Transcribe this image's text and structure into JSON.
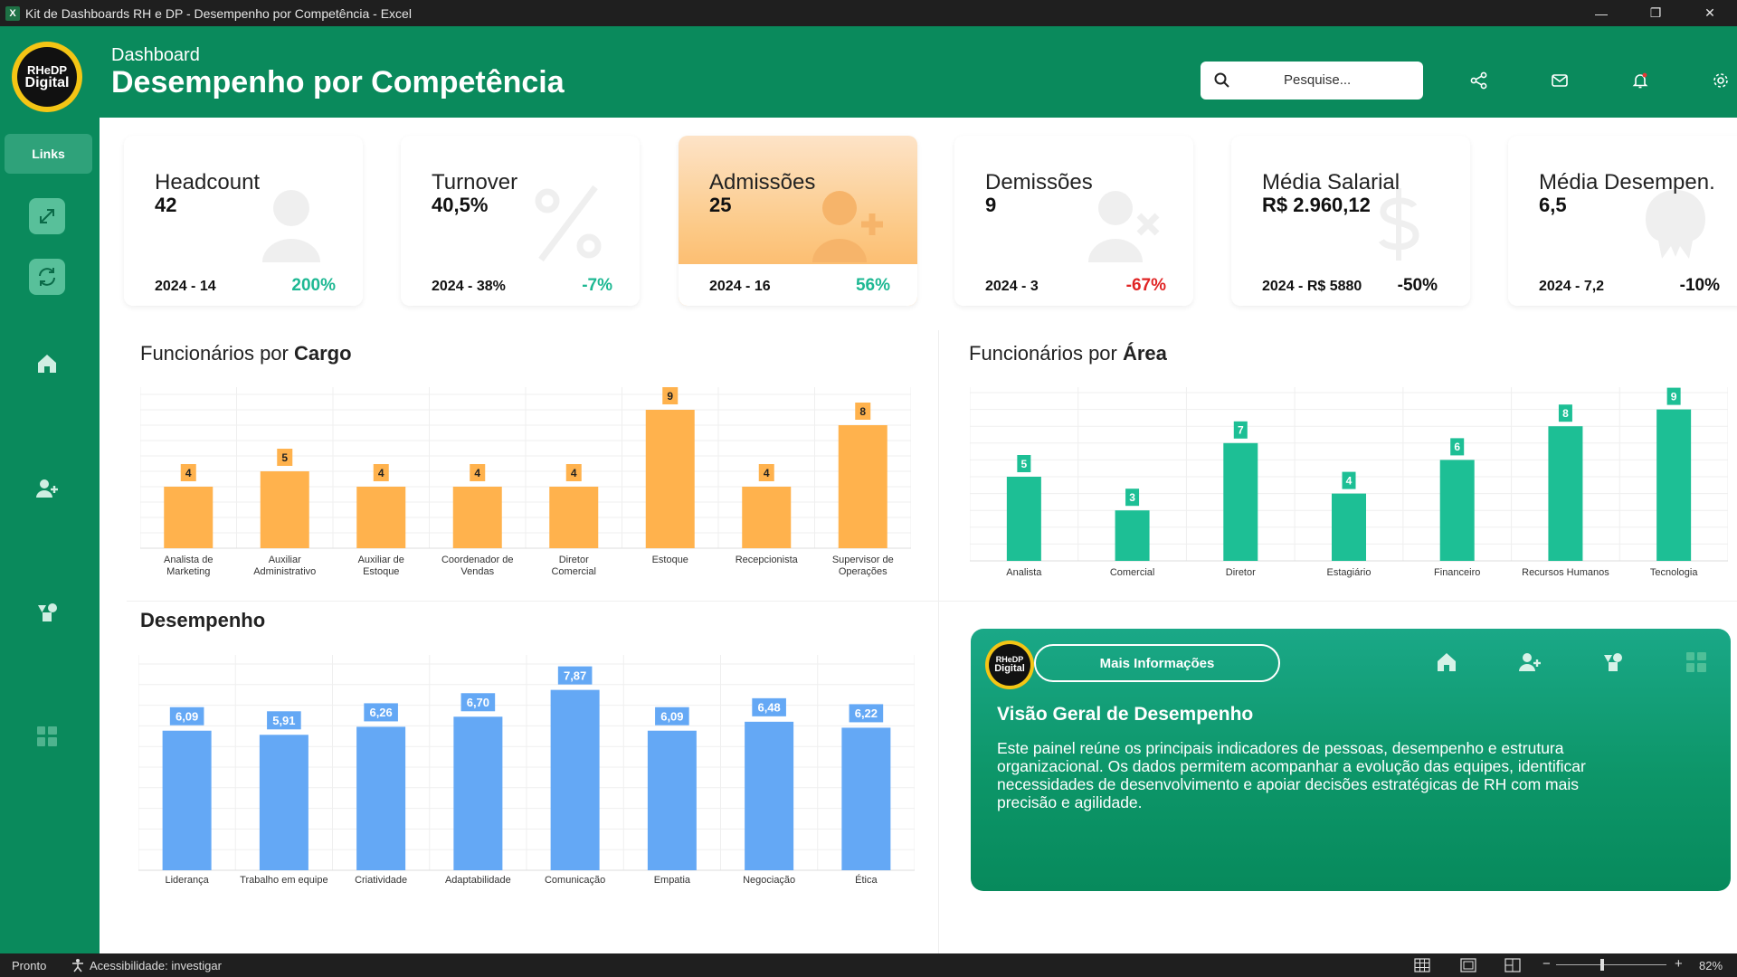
{
  "window": {
    "title": "Kit de Dashboards RH e DP - Desempenho por Competência - Excel",
    "app_icon": "X",
    "minimize": "—",
    "restore": "❐",
    "close": "✕"
  },
  "logo": {
    "line1": "RHeDP",
    "line2": "Digital"
  },
  "header": {
    "subtitle": "Dashboard",
    "title": "Desempenho por Competência",
    "search_placeholder": "Pesquise..."
  },
  "sidebar": {
    "links_label": "Links"
  },
  "kpis": [
    {
      "label": "Headcount",
      "value": "42",
      "prev": "2024 - 14",
      "pct": "200%",
      "trend": "pos",
      "icon": "person-icon"
    },
    {
      "label": "Turnover",
      "value": "40,5%",
      "prev": "2024 - 38%",
      "pct": "-7%",
      "trend": "pos",
      "icon": "percent-icon"
    },
    {
      "label": "Admissões",
      "value": "25",
      "prev": "2024 - 16",
      "pct": "56%",
      "trend": "pos",
      "icon": "person-add-icon"
    },
    {
      "label": "Demissões",
      "value": "9",
      "prev": "2024 - 3",
      "pct": "-67%",
      "trend": "neg",
      "icon": "person-remove-icon"
    },
    {
      "label": "Média Salarial",
      "value": "R$ 2.960,12",
      "prev": "2024 - R$ 5880",
      "pct": "-50%",
      "trend": "neutral",
      "icon": "dollar-icon"
    },
    {
      "label": "Média Desempen.",
      "value": "6,5",
      "prev": "2024 - 7,2",
      "pct": "-10%",
      "trend": "neutral",
      "icon": "performance-icon"
    }
  ],
  "sections": {
    "cargo_prefix": "Funcionários por ",
    "cargo_bold": "Cargo",
    "area_prefix": "Funcionários por ",
    "area_bold": "Área",
    "desempenho": "Desempenho"
  },
  "chart_data": [
    {
      "type": "bar",
      "categories": [
        "Analista de Marketing",
        "Auxiliar Administrativo",
        "Auxiliar de Estoque",
        "Coordenador de Vendas",
        "Diretor Comercial",
        "Estoque",
        "Recepcionista",
        "Supervisor de Operações"
      ],
      "values": [
        4,
        5,
        4,
        4,
        4,
        9,
        4,
        8
      ],
      "labels": [
        "4",
        "5",
        "4",
        "4",
        "4",
        "9",
        "4",
        "8"
      ],
      "color": "#ffb24d",
      "ylim": [
        0,
        10
      ],
      "grid": true
    },
    {
      "type": "bar",
      "categories": [
        "Analista",
        "Comercial",
        "Diretor",
        "Estagiário",
        "Financeiro",
        "Recursos Humanos",
        "Tecnologia"
      ],
      "values": [
        5,
        3,
        7,
        4,
        6,
        8,
        9
      ],
      "labels": [
        "5",
        "3",
        "7",
        "4",
        "6",
        "8",
        "9"
      ],
      "color": "#1dbf95",
      "ylim": [
        0,
        10
      ],
      "grid": true
    },
    {
      "type": "bar",
      "categories": [
        "Liderança",
        "Trabalho em equipe",
        "Criatividade",
        "Adaptabilidade",
        "Comunicação",
        "Empatia",
        "Negociação",
        "Ética"
      ],
      "values": [
        6.09,
        5.91,
        6.26,
        6.7,
        7.87,
        6.09,
        6.48,
        6.22
      ],
      "labels": [
        "6,09",
        "5,91",
        "6,26",
        "6,70",
        "7,87",
        "6,09",
        "6,48",
        "6,22"
      ],
      "color": "#64a8f5",
      "ylim": [
        0,
        9
      ],
      "grid": true
    }
  ],
  "info": {
    "button": "Mais Informações",
    "title": "Visão Geral de Desempenho",
    "text": "Este painel reúne os principais indicadores de pessoas, desempenho e estrutura organizacional. Os dados permitem acompanhar a evolução das equipes, identificar necessidades de desenvolvimento e apoiar decisões estratégicas de RH com mais precisão e agilidade."
  },
  "status": {
    "ready": "Pronto",
    "accessibility": "Acessibilidade: investigar",
    "zoom": "82%",
    "zoom_minus": "−",
    "zoom_plus": "+"
  },
  "colors": {
    "brand_green": "#0a8a5c",
    "orange": "#ffb24d",
    "teal": "#1dbf95",
    "blue": "#64a8f5",
    "positive": "#1eb893",
    "negative": "#e02424"
  }
}
